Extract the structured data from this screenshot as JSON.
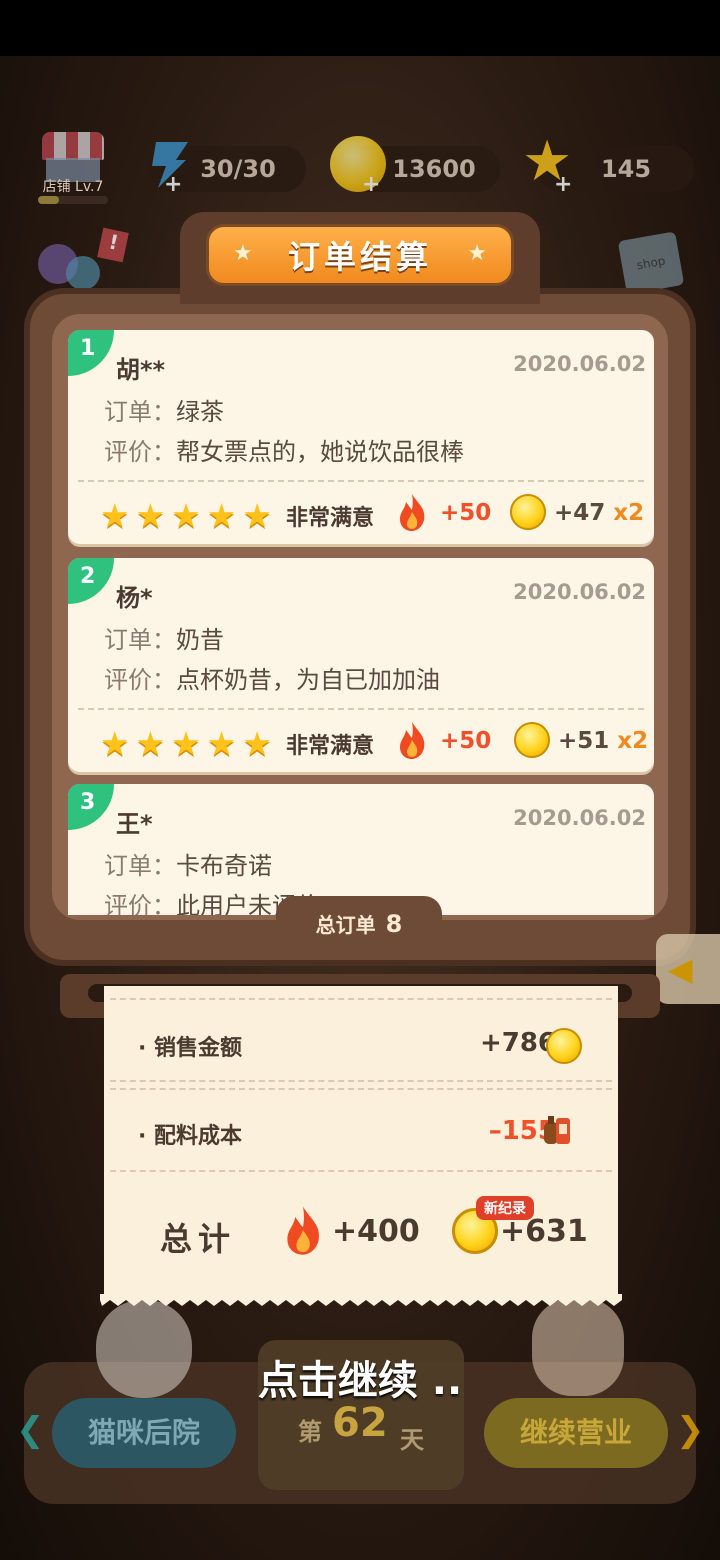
{
  "header": {
    "shop_level": "店铺 Lv.7",
    "shop_progress": 0.3,
    "energy": "30/30",
    "gold": "13600",
    "stars": "145",
    "plus": "+"
  },
  "title": "订单结算",
  "orders": [
    {
      "index": "1",
      "name": "胡**",
      "date": "2020.06.02",
      "order_label": "订单：",
      "order": "绿茶",
      "review_label": "评价：",
      "review": "帮女票点的，她说饮品很棒",
      "rating": 5,
      "satisfaction": "非常满意",
      "heat": "+50",
      "coins": "+47",
      "mult": "x2"
    },
    {
      "index": "2",
      "name": "杨*",
      "date": "2020.06.02",
      "order_label": "订单：",
      "order": "奶昔",
      "review_label": "评价：",
      "review": "点杯奶昔，为自已加加油",
      "rating": 5,
      "satisfaction": "非常满意",
      "heat": "+50",
      "coins": "+51",
      "mult": "x2"
    },
    {
      "index": "3",
      "name": "王*",
      "date": "2020.06.02",
      "order_label": "订单：",
      "order": "卡布奇诺",
      "review_label": "评价：",
      "review": "此用户未评价",
      "rating": 0,
      "satisfaction": "",
      "heat": "",
      "coins": "",
      "mult": ""
    }
  ],
  "total_orders_label": "总订单",
  "total_orders": "8",
  "receipt": {
    "sales_label": "销售金额",
    "sales_value": "+786",
    "cost_label": "配料成本",
    "cost_value": "–155",
    "total_label": "总计",
    "total_heat": "+400",
    "total_gold": "+631",
    "new_record": "新纪录"
  },
  "bottom": {
    "left_button": "猫咪后院",
    "right_button": "继续营业",
    "day_prefix": "第",
    "day": "62",
    "day_suffix": "天",
    "tap_continue": "点击继续 .."
  },
  "colors": {
    "accent": "#f08a1e",
    "green_badge": "#2ec27e",
    "heat": "#f0502a",
    "star": "#ffc21a"
  }
}
